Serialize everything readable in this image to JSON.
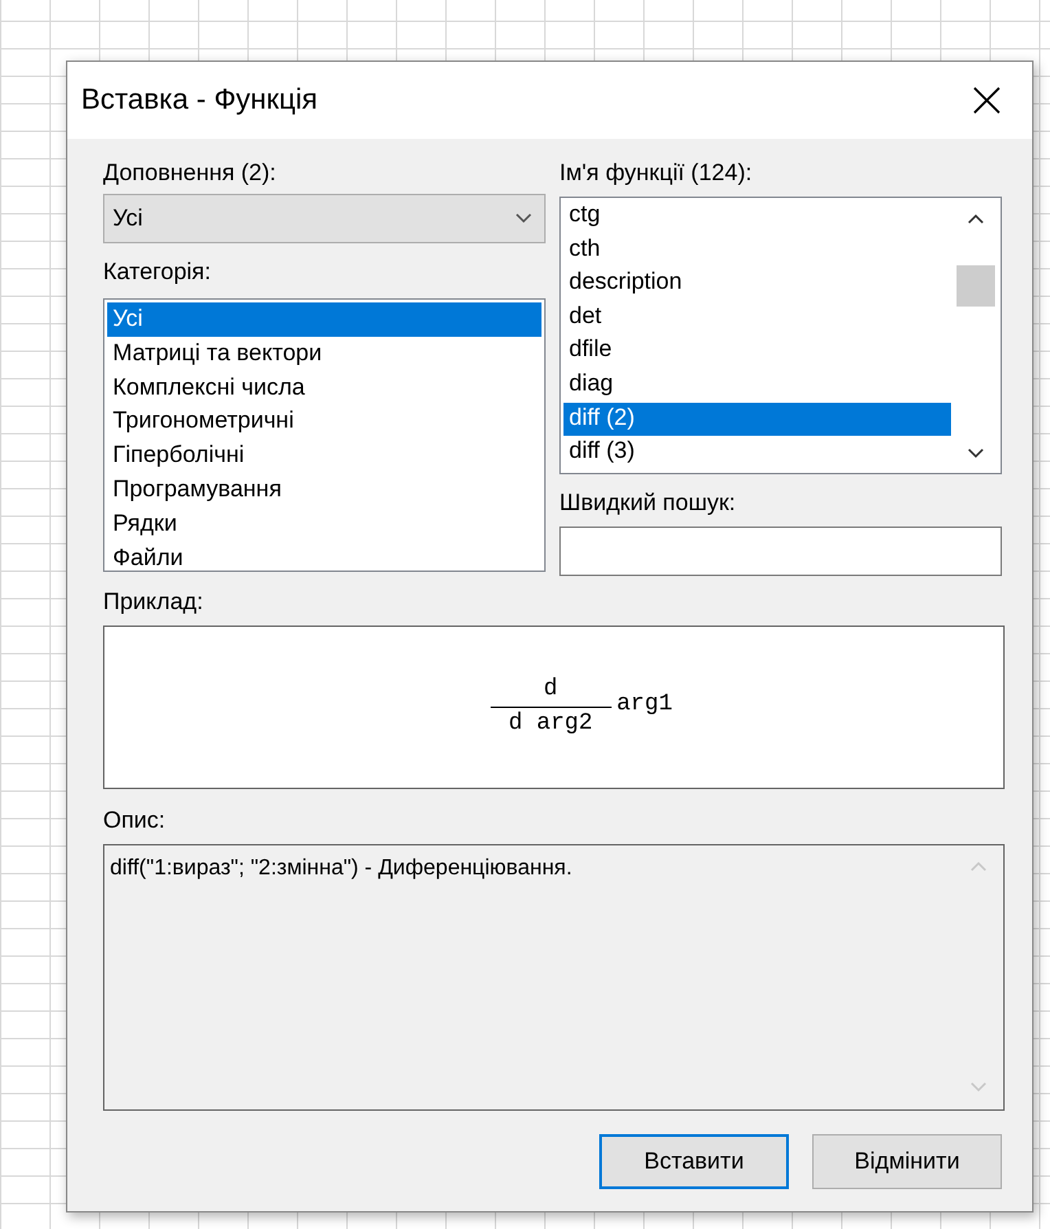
{
  "window": {
    "title": "Вставка - Функція"
  },
  "addons": {
    "label": "Доповнення (2):",
    "value": "Усі"
  },
  "category": {
    "label": "Категорія:",
    "items": [
      {
        "label": "Усі",
        "selected": true
      },
      {
        "label": "Матриці та вектори",
        "selected": false
      },
      {
        "label": "Комплексні числа",
        "selected": false
      },
      {
        "label": "Тригонометричні",
        "selected": false
      },
      {
        "label": "Гіперболічні",
        "selected": false
      },
      {
        "label": "Програмування",
        "selected": false
      },
      {
        "label": "Рядки",
        "selected": false
      },
      {
        "label": "Файли",
        "selected": false
      }
    ]
  },
  "functions": {
    "label": "Ім'я функції (124):",
    "items": [
      {
        "label": "ctg",
        "selected": false
      },
      {
        "label": "cth",
        "selected": false
      },
      {
        "label": "description",
        "selected": false
      },
      {
        "label": "det",
        "selected": false
      },
      {
        "label": "dfile",
        "selected": false
      },
      {
        "label": "diag",
        "selected": false
      },
      {
        "label": "diff (2)",
        "selected": true
      },
      {
        "label": "diff (3)",
        "selected": false
      }
    ]
  },
  "quick_search": {
    "label": "Швидкий пошук:"
  },
  "example": {
    "label": "Приклад:",
    "formula": {
      "numerator": "d",
      "denominator": "d arg2",
      "operand": "arg1"
    }
  },
  "description": {
    "label": "Опис:",
    "text": "diff(\"1:вираз\"; \"2:змінна\") - Диференціювання."
  },
  "buttons": [
    {
      "label": "Вставити",
      "default": true
    },
    {
      "label": "Відмінити",
      "default": false
    }
  ]
}
